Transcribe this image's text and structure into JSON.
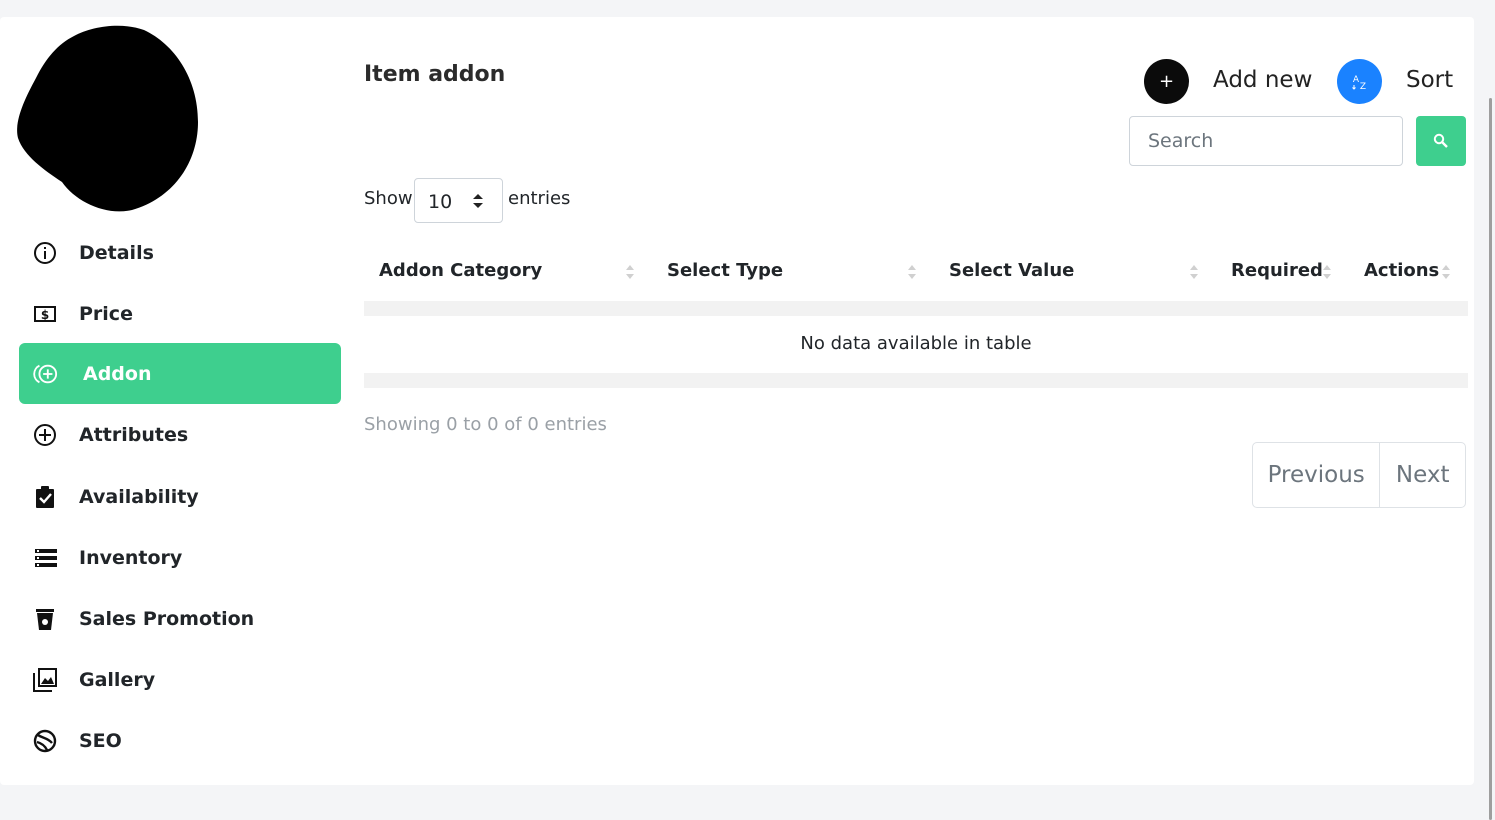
{
  "sidebar": {
    "items": [
      {
        "label": "Details",
        "icon": "info-circle-icon"
      },
      {
        "label": "Price",
        "icon": "dollar-bill-icon"
      },
      {
        "label": "Addon",
        "icon": "addon-circle-plus-icon",
        "active": true
      },
      {
        "label": "Attributes",
        "icon": "plus-circle-icon"
      },
      {
        "label": "Availability",
        "icon": "clipboard-check-icon"
      },
      {
        "label": "Inventory",
        "icon": "stacked-list-icon"
      },
      {
        "label": "Sales Promotion",
        "icon": "cup-icon"
      },
      {
        "label": "Gallery",
        "icon": "image-stack-icon"
      },
      {
        "label": "SEO",
        "icon": "globe-slash-icon"
      }
    ]
  },
  "main": {
    "title": "Item addon",
    "add_new_label": "Add new",
    "sort_label": "Sort",
    "add_icon": "+",
    "search": {
      "placeholder": "Search",
      "value": ""
    },
    "length": {
      "prefix": "Show",
      "value": "10",
      "suffix": "entries"
    },
    "table": {
      "columns": [
        "Addon Category",
        "Select Type",
        "Select Value",
        "Required",
        "Actions"
      ],
      "empty_message": "No data available in table"
    },
    "info": "Showing 0 to 0 of 0 entries",
    "pagination": {
      "previous": "Previous",
      "next": "Next"
    }
  },
  "colors": {
    "accent": "#3ecf8e",
    "sort_button": "#1a82ff",
    "add_button": "#0b0b0b",
    "background": "#f4f5f7"
  }
}
